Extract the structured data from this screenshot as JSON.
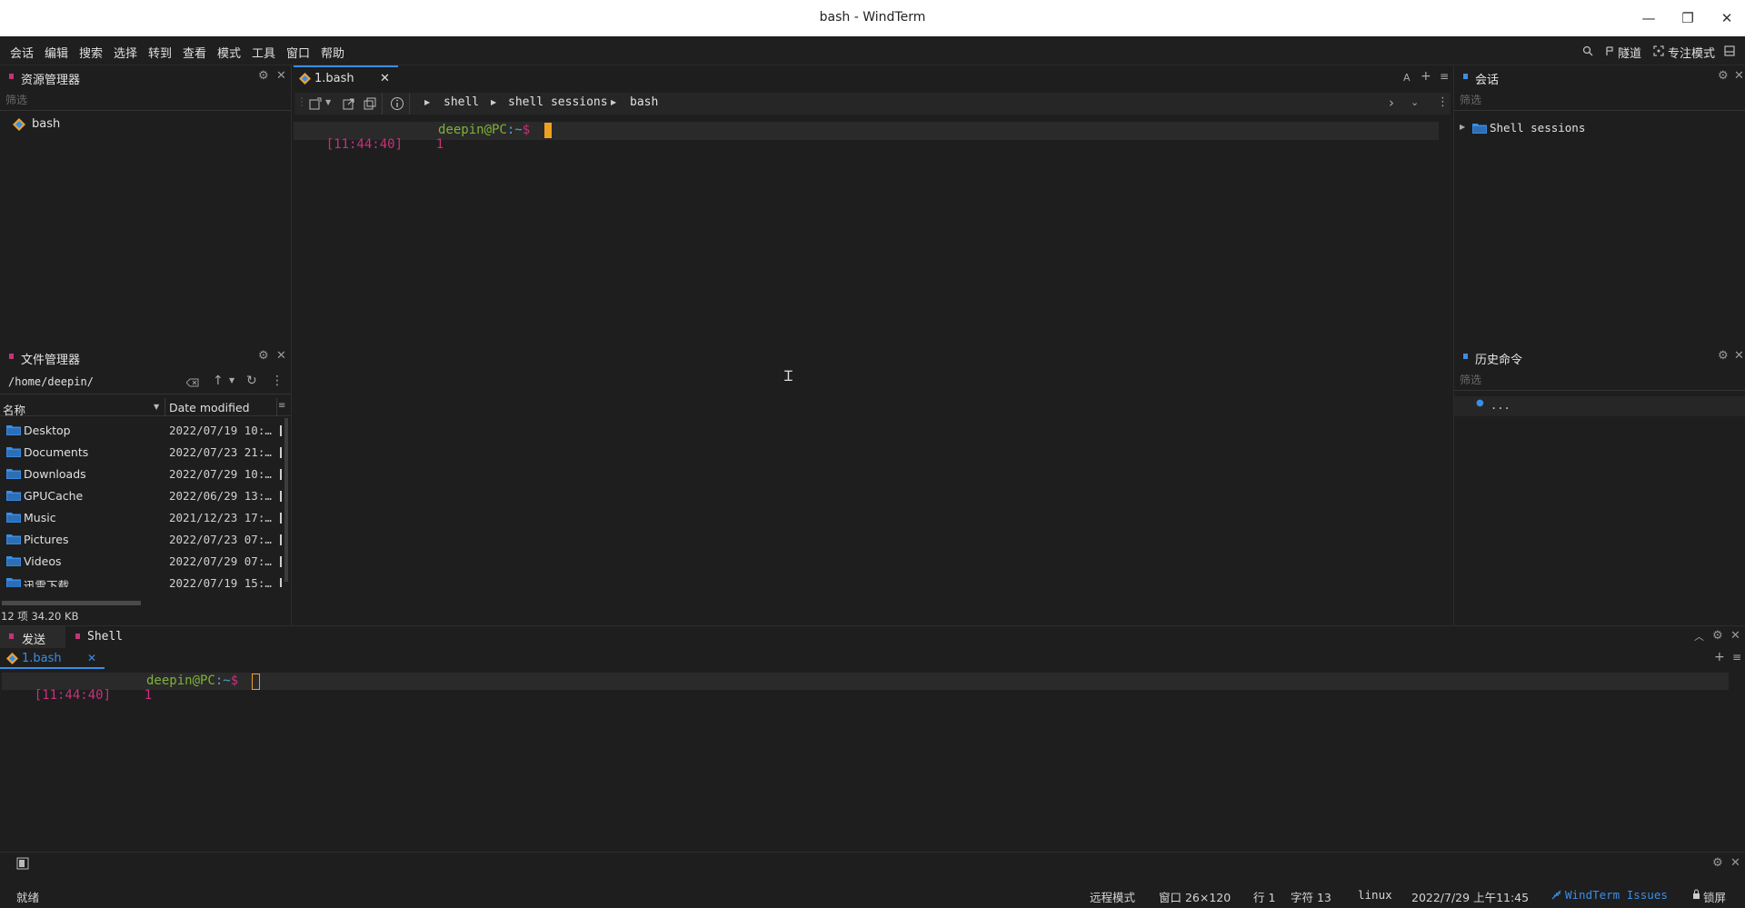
{
  "window": {
    "title": "bash - WindTerm",
    "minimize": "—",
    "restore": "❐",
    "close": "✕"
  },
  "menu": {
    "items": [
      "会话",
      "编辑",
      "搜索",
      "选择",
      "转到",
      "查看",
      "模式",
      "工具",
      "窗口",
      "帮助"
    ],
    "tunnel": "隧道",
    "focus_mode": "专注模式"
  },
  "explorer": {
    "title": "资源管理器",
    "filter_placeholder": "筛选",
    "items": [
      {
        "label": "bash"
      }
    ]
  },
  "file_manager": {
    "title": "文件管理器",
    "path": "/home/deepin/",
    "columns": {
      "name": "名称",
      "date": "Date modified"
    },
    "rows": [
      {
        "name": "Desktop",
        "date": "2022/07/19 10:…"
      },
      {
        "name": "Documents",
        "date": "2022/07/23 21:…"
      },
      {
        "name": "Downloads",
        "date": "2022/07/29 10:…"
      },
      {
        "name": "GPUCache",
        "date": "2022/06/29 13:…"
      },
      {
        "name": "Music",
        "date": "2021/12/23 17:…"
      },
      {
        "name": "Pictures",
        "date": "2022/07/23 07:…"
      },
      {
        "name": "Videos",
        "date": "2022/07/29 07:…"
      },
      {
        "name": "迅雷下载",
        "date": "2022/07/19 15:…"
      }
    ],
    "summary": "12 项 34.20 KB"
  },
  "editor": {
    "tab_label": "1.bash",
    "font_btn": "A",
    "breadcrumb": [
      "shell",
      "shell sessions",
      "bash"
    ],
    "prompt": {
      "time": "[11:44:40]",
      "line": "1",
      "user": "deepin@PC",
      "path": ":~",
      "dollar": "$"
    }
  },
  "sessions": {
    "title": "会话",
    "filter_placeholder": "筛选",
    "tree": [
      {
        "label": "Shell sessions"
      }
    ]
  },
  "history": {
    "title": "历史命令",
    "filter_placeholder": "筛选",
    "items": [
      "..."
    ]
  },
  "bottom": {
    "tabs": [
      {
        "label": "发送"
      },
      {
        "label": "Shell"
      }
    ],
    "sub_tab": "1.bash",
    "prompt": {
      "time": "[11:44:40]",
      "line": "1",
      "user": "deepin@PC",
      "path": ":~",
      "dollar": "$"
    }
  },
  "status": {
    "ready": "就绪",
    "remote_mode": "远程模式",
    "window": "窗口 26×120",
    "row": "行 1",
    "chars": "字符 13",
    "os": "linux",
    "datetime": "2022/7/29 上午11:45",
    "issues": "WindTerm Issues",
    "lock": "锁屏"
  },
  "colors": {
    "accent": "#3a8ee6",
    "prompt_pink": "#c8317c",
    "prompt_green": "#7fb238",
    "cursor": "#f0a020",
    "folder": "#3a8ee6"
  }
}
